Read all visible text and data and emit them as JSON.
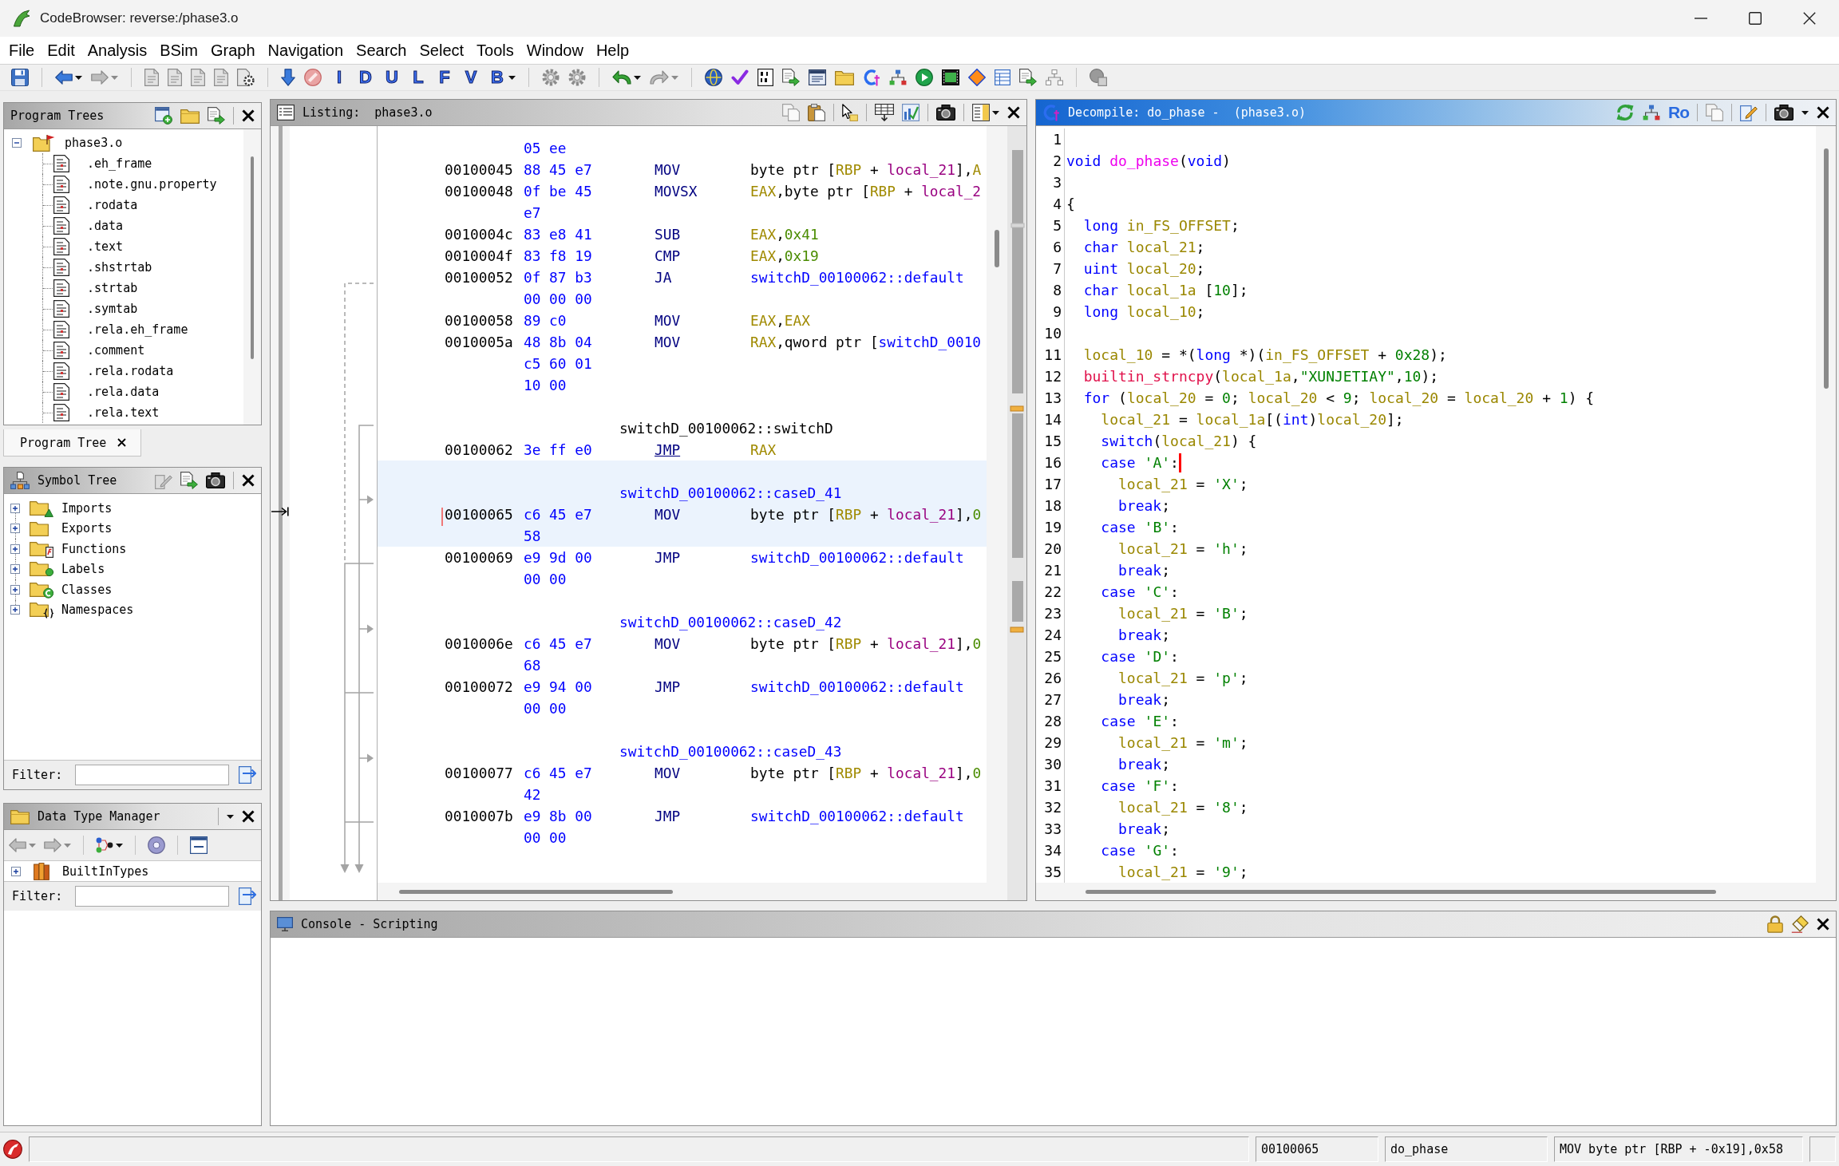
{
  "window": {
    "title": "CodeBrowser: reverse:/phase3.o"
  },
  "menu": [
    "File",
    "Edit",
    "Analysis",
    "BSim",
    "Graph",
    "Navigation",
    "Search",
    "Select",
    "Tools",
    "Window",
    "Help"
  ],
  "toolbar": {
    "letter_buttons": [
      "I",
      "D",
      "U",
      "L",
      "F",
      "V",
      "B"
    ]
  },
  "program_trees": {
    "title": "Program Trees",
    "focused": false,
    "tree": {
      "label": "phase3.o",
      "expanded": true,
      "children": [
        {
          "label": ".eh_frame"
        },
        {
          "label": ".note.gnu.property"
        },
        {
          "label": ".rodata"
        },
        {
          "label": ".data"
        },
        {
          "label": ".text"
        },
        {
          "label": ".shstrtab"
        },
        {
          "label": ".strtab"
        },
        {
          "label": ".symtab"
        },
        {
          "label": ".rela.eh_frame"
        },
        {
          "label": ".comment"
        },
        {
          "label": ".rela.rodata"
        },
        {
          "label": ".rela.data"
        },
        {
          "label": ".rela.text"
        }
      ]
    },
    "tabs": [
      {
        "label": "Program Tree",
        "selected": true
      }
    ]
  },
  "symbol_tree": {
    "title": "Symbol Tree",
    "focused": false,
    "items": [
      {
        "label": "Imports",
        "expanded": false
      },
      {
        "label": "Exports",
        "expanded": false
      },
      {
        "label": "Functions",
        "expanded": false
      },
      {
        "label": "Labels",
        "expanded": false
      },
      {
        "label": "Classes",
        "expanded": false
      },
      {
        "label": "Namespaces",
        "expanded": false
      }
    ],
    "filter_label": "Filter:"
  },
  "data_type_manager": {
    "title": "Data Type Manager",
    "focused": false,
    "items": [
      {
        "label": "BuiltInTypes",
        "expanded": false
      }
    ],
    "filter_label": "Filter:"
  },
  "listing": {
    "title": "Listing:",
    "program": "phase3.o",
    "focused": false,
    "blocks": [
      {
        "bytes": [
          "05 ee"
        ],
        "selected": false
      },
      {
        "address": "00100045",
        "bytes": [
          "88 45 e7"
        ],
        "mnemonic": "MOV",
        "underlined": false,
        "selected": false,
        "operands": [
          {
            "text": "byte ptr [",
            "kind": "plain"
          },
          {
            "text": "RBP",
            "kind": "register"
          },
          {
            "text": " + ",
            "kind": "plain"
          },
          {
            "text": "local_21",
            "kind": "variable"
          },
          {
            "text": "],",
            "kind": "plain"
          },
          {
            "text": "A",
            "kind": "register"
          }
        ]
      },
      {
        "address": "00100048",
        "bytes": [
          "0f be 45",
          "e7"
        ],
        "mnemonic": "MOVSX",
        "underlined": false,
        "selected": false,
        "operands": [
          {
            "text": "EAX",
            "kind": "register"
          },
          {
            "text": ",byte ptr [",
            "kind": "plain"
          },
          {
            "text": "RBP",
            "kind": "register"
          },
          {
            "text": " + ",
            "kind": "plain"
          },
          {
            "text": "local_2",
            "kind": "variable"
          }
        ]
      },
      {
        "address": "0010004c",
        "bytes": [
          "83 e8 41"
        ],
        "mnemonic": "SUB",
        "underlined": false,
        "selected": false,
        "operands": [
          {
            "text": "EAX",
            "kind": "register"
          },
          {
            "text": ",",
            "kind": "plain"
          },
          {
            "text": "0x41",
            "kind": "scalar"
          }
        ]
      },
      {
        "address": "0010004f",
        "bytes": [
          "83 f8 19"
        ],
        "mnemonic": "CMP",
        "underlined": false,
        "selected": false,
        "operands": [
          {
            "text": "EAX",
            "kind": "register"
          },
          {
            "text": ",",
            "kind": "plain"
          },
          {
            "text": "0x19",
            "kind": "scalar"
          }
        ]
      },
      {
        "address": "00100052",
        "bytes": [
          "0f 87 b3",
          "00 00 00"
        ],
        "mnemonic": "JA",
        "underlined": false,
        "selected": false,
        "operands": [
          {
            "text": "switchD_00100062::default",
            "kind": "reference"
          }
        ]
      },
      {
        "address": "00100058",
        "bytes": [
          "89 c0"
        ],
        "mnemonic": "MOV",
        "underlined": false,
        "selected": false,
        "operands": [
          {
            "text": "EAX",
            "kind": "register"
          },
          {
            "text": ",",
            "kind": "plain"
          },
          {
            "text": "EAX",
            "kind": "register"
          }
        ]
      },
      {
        "address": "0010005a",
        "bytes": [
          "48 8b 04",
          "c5 60 01",
          "10 00"
        ],
        "mnemonic": "MOV",
        "underlined": false,
        "selected": false,
        "operands": [
          {
            "text": "RAX",
            "kind": "register"
          },
          {
            "text": ",qword ptr [",
            "kind": "plain"
          },
          {
            "text": "switchD_0010",
            "kind": "reference"
          }
        ]
      },
      {
        "label": {
          "text": "switchD_00100062::switchD",
          "kind": "plain"
        },
        "address": "00100062",
        "bytes": [
          "3e ff e0"
        ],
        "mnemonic": "JMP",
        "underlined": true,
        "selected": false,
        "operands": [
          {
            "text": "RAX",
            "kind": "register"
          }
        ]
      },
      {
        "label": {
          "text": "switchD_00100062::caseD_41",
          "kind": "reference"
        },
        "address": "00100065",
        "bytes": [
          "c6 45 e7",
          "58"
        ],
        "mnemonic": "MOV",
        "underlined": false,
        "selected": true,
        "operands": [
          {
            "text": "byte ptr [",
            "kind": "plain"
          },
          {
            "text": "RBP",
            "kind": "register"
          },
          {
            "text": " + ",
            "kind": "plain"
          },
          {
            "text": "local_21",
            "kind": "variable"
          },
          {
            "text": "],",
            "kind": "plain"
          },
          {
            "text": "0",
            "kind": "scalar"
          }
        ]
      },
      {
        "address": "00100069",
        "bytes": [
          "e9 9d 00",
          "00 00"
        ],
        "mnemonic": "JMP",
        "underlined": false,
        "selected": false,
        "operands": [
          {
            "text": "switchD_00100062::default",
            "kind": "reference"
          }
        ]
      },
      {
        "label": {
          "text": "switchD_00100062::caseD_42",
          "kind": "reference"
        },
        "address": "0010006e",
        "bytes": [
          "c6 45 e7",
          "68"
        ],
        "mnemonic": "MOV",
        "underlined": false,
        "selected": false,
        "operands": [
          {
            "text": "byte ptr [",
            "kind": "plain"
          },
          {
            "text": "RBP",
            "kind": "register"
          },
          {
            "text": " + ",
            "kind": "plain"
          },
          {
            "text": "local_21",
            "kind": "variable"
          },
          {
            "text": "],",
            "kind": "plain"
          },
          {
            "text": "0",
            "kind": "scalar"
          }
        ]
      },
      {
        "address": "00100072",
        "bytes": [
          "e9 94 00",
          "00 00"
        ],
        "mnemonic": "JMP",
        "underlined": false,
        "selected": false,
        "operands": [
          {
            "text": "switchD_00100062::default",
            "kind": "reference"
          }
        ]
      },
      {
        "label": {
          "text": "switchD_00100062::caseD_43",
          "kind": "reference"
        },
        "address": "00100077",
        "bytes": [
          "c6 45 e7",
          "42"
        ],
        "mnemonic": "MOV",
        "underlined": false,
        "selected": false,
        "operands": [
          {
            "text": "byte ptr [",
            "kind": "plain"
          },
          {
            "text": "RBP",
            "kind": "register"
          },
          {
            "text": " + ",
            "kind": "plain"
          },
          {
            "text": "local_21",
            "kind": "variable"
          },
          {
            "text": "],",
            "kind": "plain"
          },
          {
            "text": "0",
            "kind": "scalar"
          }
        ]
      },
      {
        "address": "0010007b",
        "bytes": [
          "e9 8b 00",
          "00 00"
        ],
        "mnemonic": "JMP",
        "underlined": false,
        "selected": false,
        "operands": [
          {
            "text": "switchD_00100062::default",
            "kind": "reference"
          }
        ]
      }
    ]
  },
  "decompile": {
    "title": "Decompile: do_phase -",
    "program": "(phase3.o)",
    "focused": true,
    "toolbar_label": "Ro",
    "lines": [
      {
        "number": "1",
        "cursor": false
      },
      {
        "number": "2",
        "cursor": false,
        "tokens": [
          {
            "text": "void",
            "kind": "keyword"
          },
          {
            "text": " do_phase",
            "kind": "function"
          },
          {
            "text": "(",
            "kind": "plain"
          },
          {
            "text": "void",
            "kind": "keyword"
          },
          {
            "text": ")",
            "kind": "plain"
          }
        ]
      },
      {
        "number": "3",
        "cursor": false
      },
      {
        "number": "4",
        "cursor": false,
        "tokens": [
          {
            "text": "{",
            "kind": "plain"
          }
        ]
      },
      {
        "number": "5",
        "cursor": false,
        "tokens": [
          {
            "text": "  long",
            "kind": "keyword"
          },
          {
            "text": " in_FS_OFFSET",
            "kind": "variable"
          },
          {
            "text": ";",
            "kind": "plain"
          }
        ]
      },
      {
        "number": "6",
        "cursor": false,
        "tokens": [
          {
            "text": "  char",
            "kind": "keyword"
          },
          {
            "text": " local_21",
            "kind": "variable"
          },
          {
            "text": ";",
            "kind": "plain"
          }
        ]
      },
      {
        "number": "7",
        "cursor": false,
        "tokens": [
          {
            "text": "  uint",
            "kind": "keyword"
          },
          {
            "text": " local_20",
            "kind": "variable"
          },
          {
            "text": ";",
            "kind": "plain"
          }
        ]
      },
      {
        "number": "8",
        "cursor": false,
        "tokens": [
          {
            "text": "  char",
            "kind": "keyword"
          },
          {
            "text": " local_1a",
            "kind": "variable"
          },
          {
            "text": " [",
            "kind": "plain"
          },
          {
            "text": "10",
            "kind": "constant"
          },
          {
            "text": "];",
            "kind": "plain"
          }
        ]
      },
      {
        "number": "9",
        "cursor": false,
        "tokens": [
          {
            "text": "  long",
            "kind": "keyword"
          },
          {
            "text": " local_10",
            "kind": "variable"
          },
          {
            "text": ";",
            "kind": "plain"
          }
        ]
      },
      {
        "number": "10",
        "cursor": false
      },
      {
        "number": "11",
        "cursor": false,
        "tokens": [
          {
            "text": "  local_10",
            "kind": "variable"
          },
          {
            "text": " = *(",
            "kind": "plain"
          },
          {
            "text": "long",
            "kind": "keyword"
          },
          {
            "text": " *)(",
            "kind": "plain"
          },
          {
            "text": "in_FS_OFFSET",
            "kind": "variable"
          },
          {
            "text": " + ",
            "kind": "plain"
          },
          {
            "text": "0x28",
            "kind": "constant"
          },
          {
            "text": ");",
            "kind": "plain"
          }
        ]
      },
      {
        "number": "12",
        "cursor": false,
        "tokens": [
          {
            "text": "  builtin_strncpy",
            "kind": "call"
          },
          {
            "text": "(",
            "kind": "plain"
          },
          {
            "text": "local_1a",
            "kind": "variable"
          },
          {
            "text": ",",
            "kind": "plain"
          },
          {
            "text": "\"XUNJETIAY\"",
            "kind": "constant"
          },
          {
            "text": ",",
            "kind": "plain"
          },
          {
            "text": "10",
            "kind": "constant"
          },
          {
            "text": ");",
            "kind": "plain"
          }
        ]
      },
      {
        "number": "13",
        "cursor": false,
        "tokens": [
          {
            "text": "  for",
            "kind": "keyword"
          },
          {
            "text": " (",
            "kind": "plain"
          },
          {
            "text": "local_20",
            "kind": "variable"
          },
          {
            "text": " = ",
            "kind": "plain"
          },
          {
            "text": "0",
            "kind": "constant"
          },
          {
            "text": "; ",
            "kind": "plain"
          },
          {
            "text": "local_20",
            "kind": "variable"
          },
          {
            "text": " < ",
            "kind": "plain"
          },
          {
            "text": "9",
            "kind": "constant"
          },
          {
            "text": "; ",
            "kind": "plain"
          },
          {
            "text": "local_20",
            "kind": "variable"
          },
          {
            "text": " = ",
            "kind": "plain"
          },
          {
            "text": "local_20",
            "kind": "variable"
          },
          {
            "text": " + ",
            "kind": "plain"
          },
          {
            "text": "1",
            "kind": "constant"
          },
          {
            "text": ") {",
            "kind": "plain"
          }
        ]
      },
      {
        "number": "14",
        "cursor": false,
        "tokens": [
          {
            "text": "    local_21",
            "kind": "variable"
          },
          {
            "text": " = ",
            "kind": "plain"
          },
          {
            "text": "local_1a",
            "kind": "variable"
          },
          {
            "text": "[(",
            "kind": "plain"
          },
          {
            "text": "int",
            "kind": "keyword"
          },
          {
            "text": ")",
            "kind": "plain"
          },
          {
            "text": "local_20",
            "kind": "variable"
          },
          {
            "text": "];",
            "kind": "plain"
          }
        ]
      },
      {
        "number": "15",
        "cursor": false,
        "tokens": [
          {
            "text": "    switch",
            "kind": "keyword"
          },
          {
            "text": "(",
            "kind": "plain"
          },
          {
            "text": "local_21",
            "kind": "variable"
          },
          {
            "text": ") {",
            "kind": "plain"
          }
        ]
      },
      {
        "number": "16",
        "cursor": true,
        "tokens": [
          {
            "text": "    case",
            "kind": "keyword"
          },
          {
            "text": " 'A'",
            "kind": "constant"
          },
          {
            "text": ":",
            "kind": "plain"
          }
        ]
      },
      {
        "number": "17",
        "cursor": false,
        "tokens": [
          {
            "text": "      local_21",
            "kind": "variable"
          },
          {
            "text": " = ",
            "kind": "plain"
          },
          {
            "text": "'X'",
            "kind": "constant"
          },
          {
            "text": ";",
            "kind": "plain"
          }
        ]
      },
      {
        "number": "18",
        "cursor": false,
        "tokens": [
          {
            "text": "      break",
            "kind": "keyword"
          },
          {
            "text": ";",
            "kind": "plain"
          }
        ]
      },
      {
        "number": "19",
        "cursor": false,
        "tokens": [
          {
            "text": "    case",
            "kind": "keyword"
          },
          {
            "text": " 'B'",
            "kind": "constant"
          },
          {
            "text": ":",
            "kind": "plain"
          }
        ]
      },
      {
        "number": "20",
        "cursor": false,
        "tokens": [
          {
            "text": "      local_21",
            "kind": "variable"
          },
          {
            "text": " = ",
            "kind": "plain"
          },
          {
            "text": "'h'",
            "kind": "constant"
          },
          {
            "text": ";",
            "kind": "plain"
          }
        ]
      },
      {
        "number": "21",
        "cursor": false,
        "tokens": [
          {
            "text": "      break",
            "kind": "keyword"
          },
          {
            "text": ";",
            "kind": "plain"
          }
        ]
      },
      {
        "number": "22",
        "cursor": false,
        "tokens": [
          {
            "text": "    case",
            "kind": "keyword"
          },
          {
            "text": " 'C'",
            "kind": "constant"
          },
          {
            "text": ":",
            "kind": "plain"
          }
        ]
      },
      {
        "number": "23",
        "cursor": false,
        "tokens": [
          {
            "text": "      local_21",
            "kind": "variable"
          },
          {
            "text": " = ",
            "kind": "plain"
          },
          {
            "text": "'B'",
            "kind": "constant"
          },
          {
            "text": ";",
            "kind": "plain"
          }
        ]
      },
      {
        "number": "24",
        "cursor": false,
        "tokens": [
          {
            "text": "      break",
            "kind": "keyword"
          },
          {
            "text": ";",
            "kind": "plain"
          }
        ]
      },
      {
        "number": "25",
        "cursor": false,
        "tokens": [
          {
            "text": "    case",
            "kind": "keyword"
          },
          {
            "text": " 'D'",
            "kind": "constant"
          },
          {
            "text": ":",
            "kind": "plain"
          }
        ]
      },
      {
        "number": "26",
        "cursor": false,
        "tokens": [
          {
            "text": "      local_21",
            "kind": "variable"
          },
          {
            "text": " = ",
            "kind": "plain"
          },
          {
            "text": "'p'",
            "kind": "constant"
          },
          {
            "text": ";",
            "kind": "plain"
          }
        ]
      },
      {
        "number": "27",
        "cursor": false,
        "tokens": [
          {
            "text": "      break",
            "kind": "keyword"
          },
          {
            "text": ";",
            "kind": "plain"
          }
        ]
      },
      {
        "number": "28",
        "cursor": false,
        "tokens": [
          {
            "text": "    case",
            "kind": "keyword"
          },
          {
            "text": " 'E'",
            "kind": "constant"
          },
          {
            "text": ":",
            "kind": "plain"
          }
        ]
      },
      {
        "number": "29",
        "cursor": false,
        "tokens": [
          {
            "text": "      local_21",
            "kind": "variable"
          },
          {
            "text": " = ",
            "kind": "plain"
          },
          {
            "text": "'m'",
            "kind": "constant"
          },
          {
            "text": ";",
            "kind": "plain"
          }
        ]
      },
      {
        "number": "30",
        "cursor": false,
        "tokens": [
          {
            "text": "      break",
            "kind": "keyword"
          },
          {
            "text": ";",
            "kind": "plain"
          }
        ]
      },
      {
        "number": "31",
        "cursor": false,
        "tokens": [
          {
            "text": "    case",
            "kind": "keyword"
          },
          {
            "text": " 'F'",
            "kind": "constant"
          },
          {
            "text": ":",
            "kind": "plain"
          }
        ]
      },
      {
        "number": "32",
        "cursor": false,
        "tokens": [
          {
            "text": "      local_21",
            "kind": "variable"
          },
          {
            "text": " = ",
            "kind": "plain"
          },
          {
            "text": "'8'",
            "kind": "constant"
          },
          {
            "text": ";",
            "kind": "plain"
          }
        ]
      },
      {
        "number": "33",
        "cursor": false,
        "tokens": [
          {
            "text": "      break",
            "kind": "keyword"
          },
          {
            "text": ";",
            "kind": "plain"
          }
        ]
      },
      {
        "number": "34",
        "cursor": false,
        "tokens": [
          {
            "text": "    case",
            "kind": "keyword"
          },
          {
            "text": " 'G'",
            "kind": "constant"
          },
          {
            "text": ":",
            "kind": "plain"
          }
        ]
      },
      {
        "number": "35",
        "cursor": false,
        "tokens": [
          {
            "text": "      local_21",
            "kind": "variable"
          },
          {
            "text": " = ",
            "kind": "plain"
          },
          {
            "text": "'9'",
            "kind": "constant"
          },
          {
            "text": ";",
            "kind": "plain"
          }
        ]
      }
    ]
  },
  "console": {
    "title": "Console - Scripting",
    "focused": false
  },
  "status_bar": {
    "fields": [
      "00100065",
      "do_phase",
      "MOV byte ptr [RBP + -0x19],0x58"
    ]
  }
}
